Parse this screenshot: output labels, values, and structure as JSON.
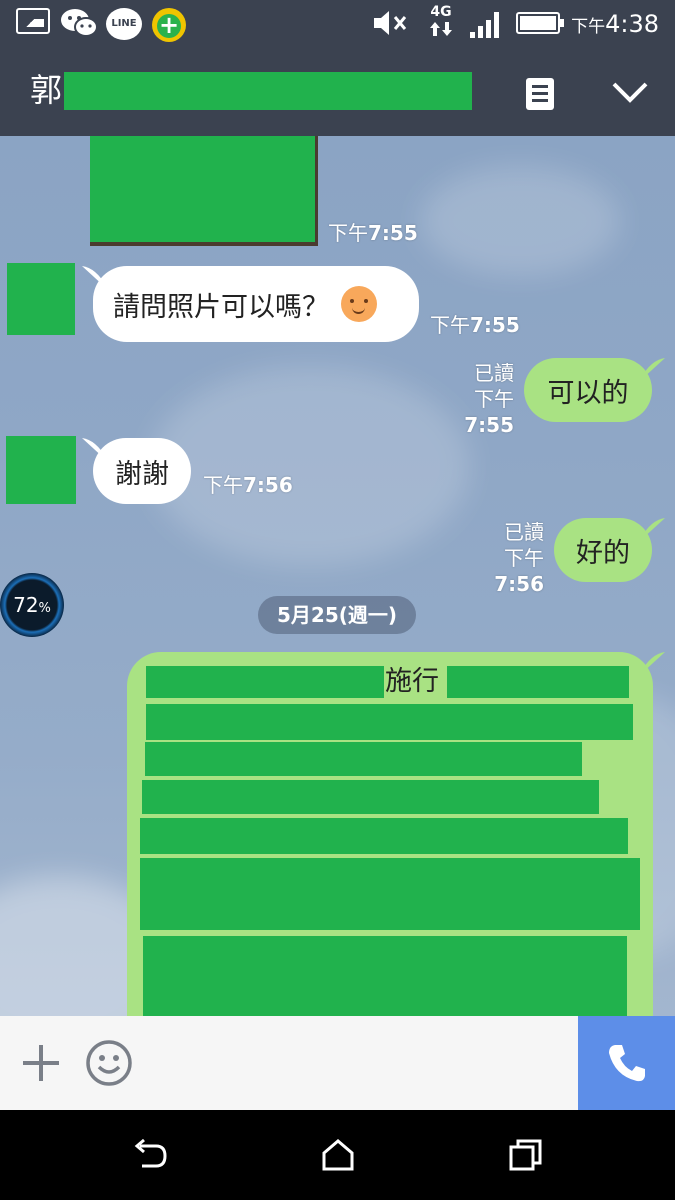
{
  "status_bar": {
    "time_prefix": "下午",
    "time": "4:38",
    "network": "4G",
    "line_label": "LINE"
  },
  "header": {
    "title_char": "郭"
  },
  "messages": [
    {
      "from": "me-photo",
      "time_prefix": "下午",
      "time": "7:55"
    },
    {
      "from": "them",
      "text": "請問照片可以嗎？",
      "emoji": "smiling-face-icon",
      "time_prefix": "下午",
      "time": "7:55"
    },
    {
      "from": "me",
      "text": "可以的",
      "read": "已讀",
      "time_prefix": "下午",
      "time": "7:55"
    },
    {
      "from": "them",
      "text": "謝謝",
      "time_prefix": "下午",
      "time": "7:56"
    },
    {
      "from": "me",
      "text": "好的",
      "read": "已讀",
      "time_prefix": "下午",
      "time": "7:56"
    }
  ],
  "date_separator": "5月25(週一)",
  "long_message_visible_text": "施行",
  "battery_widget": {
    "value": "72",
    "unit": "%"
  },
  "colors": {
    "header_bg": "#3b4250",
    "my_bubble": "#a9e283",
    "their_bubble": "#ffffff",
    "call_button": "#5d8ee8",
    "redaction": "#21b24d"
  }
}
